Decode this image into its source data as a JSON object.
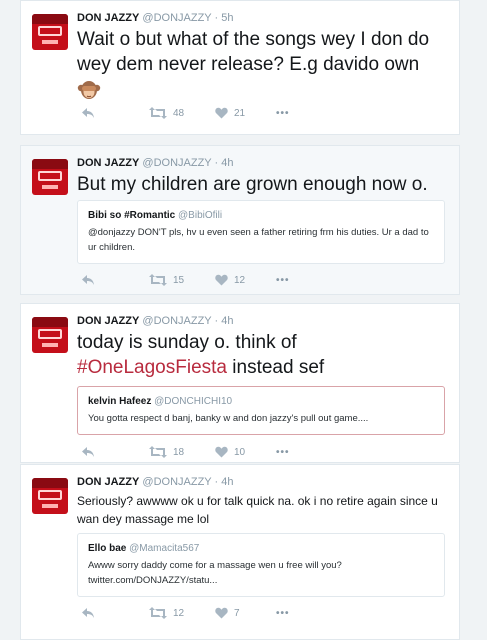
{
  "tweets": [
    {
      "name": "DON JAZZY",
      "handle": "@DONJAZZY",
      "sep": "·",
      "time": "5h",
      "text": "Wait o but what of the songs wey I don do wey dem never release? E.g davido own",
      "emoji_icon": "see-no-evil-monkey-icon",
      "retweets": "48",
      "likes": "21"
    },
    {
      "name": "DON JAZZY",
      "handle": "@DONJAZZY",
      "sep": "·",
      "time": "4h",
      "text": "But my children are grown enough now o.",
      "quote": {
        "name": "Bibi so #Romantic",
        "handle": "@BibiOfili",
        "text": "@donjazzy DON'T pls, hv u even seen a father retiring frm his duties. Ur a dad to ur children."
      },
      "retweets": "15",
      "likes": "12"
    },
    {
      "name": "DON JAZZY",
      "handle": "@DONJAZZY",
      "sep": "·",
      "time": "4h",
      "text_before": "today is sunday o. think of",
      "hashtag": "#OneLagosFiesta",
      "text_after": "instead sef",
      "quote": {
        "name": "kelvin Hafeez",
        "handle": "@DONCHICHI10",
        "text": "You gotta respect d banj, banky w and don jazzy's pull out game...."
      },
      "retweets": "18",
      "likes": "10"
    },
    {
      "name": "DON JAZZY",
      "handle": "@DONJAZZY",
      "sep": "·",
      "time": "4h",
      "text": "Seriously? awwww ok u for talk quick na. ok i no retire again since u wan dey massage me lol",
      "quote": {
        "name": "Ello bae",
        "handle": "@Mamacita567",
        "text": "Awww sorry daddy come for a massage wen u free will you? twitter.com/DONJAZZY/statu..."
      },
      "retweets": "12",
      "likes": "7"
    }
  ],
  "more_label": "•••",
  "colors": {
    "hashtag": "#b82b3e",
    "muted": "#8899a6",
    "avatar": "#c40f1a"
  }
}
